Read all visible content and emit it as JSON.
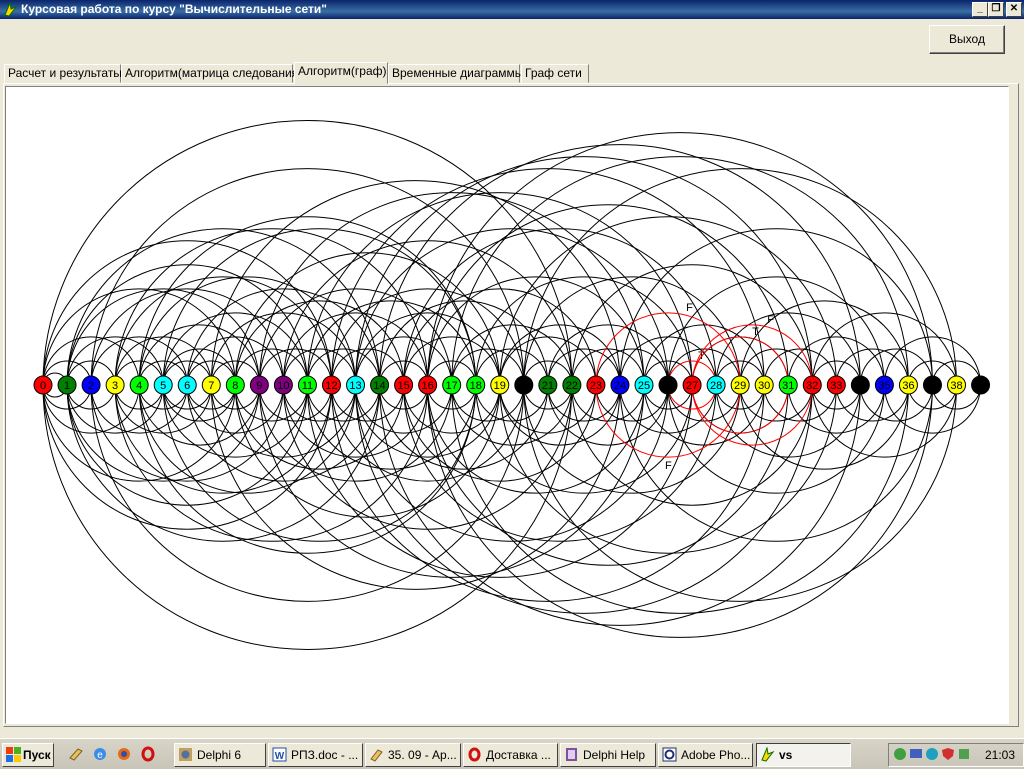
{
  "window": {
    "title": "Курсовая работа по курсу \"Вычислительные сети\""
  },
  "toolbar": {
    "exit_label": "Выход"
  },
  "tabs": [
    {
      "label": "Расчет и результаты"
    },
    {
      "label": "Алгоритм(матрица следования)"
    },
    {
      "label": "Алгоритм(граф)",
      "active": true
    },
    {
      "label": "Временные диаграммы"
    },
    {
      "label": "Граф сети"
    }
  ],
  "graph": {
    "nodes": [
      {
        "label": "0",
        "color": "#ff0000"
      },
      {
        "label": "1",
        "color": "#008000"
      },
      {
        "label": "2",
        "color": "#0000ff"
      },
      {
        "label": "3",
        "color": "#ffff00"
      },
      {
        "label": "4",
        "color": "#00ff00"
      },
      {
        "label": "5",
        "color": "#00ffff"
      },
      {
        "label": "6",
        "color": "#00ffff"
      },
      {
        "label": "7",
        "color": "#ffff00"
      },
      {
        "label": "8",
        "color": "#00ff00"
      },
      {
        "label": "9",
        "color": "#800080"
      },
      {
        "label": "10",
        "color": "#800080"
      },
      {
        "label": "11",
        "color": "#00ff00"
      },
      {
        "label": "12",
        "color": "#ff0000"
      },
      {
        "label": "13",
        "color": "#00ffff"
      },
      {
        "label": "14",
        "color": "#008000"
      },
      {
        "label": "15",
        "color": "#ff0000"
      },
      {
        "label": "16",
        "color": "#ff0000"
      },
      {
        "label": "17",
        "color": "#00ff00"
      },
      {
        "label": "18",
        "color": "#00ff00"
      },
      {
        "label": "19",
        "color": "#ffff00"
      },
      {
        "label": "20",
        "color": "#000000"
      },
      {
        "label": "21",
        "color": "#008000"
      },
      {
        "label": "22",
        "color": "#008000"
      },
      {
        "label": "23",
        "color": "#ff0000"
      },
      {
        "label": "24",
        "color": "#0000ff"
      },
      {
        "label": "25",
        "color": "#00ffff"
      },
      {
        "label": "26",
        "color": "#000000"
      },
      {
        "label": "27",
        "color": "#ff0000"
      },
      {
        "label": "28",
        "color": "#00ffff"
      },
      {
        "label": "29",
        "color": "#ffff00"
      },
      {
        "label": "30",
        "color": "#ffff00"
      },
      {
        "label": "31",
        "color": "#00ff00"
      },
      {
        "label": "32",
        "color": "#ff0000"
      },
      {
        "label": "33",
        "color": "#ff0000"
      },
      {
        "label": "34",
        "color": "#000000"
      },
      {
        "label": "35",
        "color": "#0000ff"
      },
      {
        "label": "36",
        "color": "#ffff00"
      },
      {
        "label": "37",
        "color": "#000000"
      },
      {
        "label": "38",
        "color": "#ffff00"
      },
      {
        "label": "39",
        "color": "#000000"
      }
    ],
    "edges": [
      [
        0,
        1
      ],
      [
        0,
        2
      ],
      [
        0,
        4
      ],
      [
        0,
        8
      ],
      [
        0,
        12
      ],
      [
        0,
        22
      ],
      [
        1,
        3
      ],
      [
        1,
        5
      ],
      [
        1,
        9
      ],
      [
        1,
        14
      ],
      [
        2,
        6
      ],
      [
        2,
        10
      ],
      [
        2,
        20
      ],
      [
        3,
        5
      ],
      [
        3,
        7
      ],
      [
        3,
        12
      ],
      [
        3,
        16
      ],
      [
        4,
        6
      ],
      [
        4,
        9
      ],
      [
        4,
        13
      ],
      [
        5,
        7
      ],
      [
        5,
        8
      ],
      [
        5,
        11
      ],
      [
        5,
        18
      ],
      [
        6,
        8
      ],
      [
        6,
        10
      ],
      [
        6,
        14
      ],
      [
        7,
        9
      ],
      [
        7,
        13
      ],
      [
        7,
        24
      ],
      [
        8,
        11
      ],
      [
        8,
        15
      ],
      [
        8,
        19
      ],
      [
        9,
        12
      ],
      [
        9,
        17
      ],
      [
        10,
        13
      ],
      [
        10,
        16
      ],
      [
        10,
        22
      ],
      [
        11,
        14
      ],
      [
        11,
        18
      ],
      [
        12,
        15
      ],
      [
        12,
        20
      ],
      [
        12,
        30
      ],
      [
        13,
        17
      ],
      [
        13,
        19
      ],
      [
        13,
        26
      ],
      [
        14,
        16
      ],
      [
        14,
        21
      ],
      [
        14,
        34
      ],
      [
        15,
        19
      ],
      [
        15,
        23
      ],
      [
        15,
        28
      ],
      [
        16,
        18
      ],
      [
        16,
        25
      ],
      [
        16,
        31
      ],
      [
        17,
        20
      ],
      [
        17,
        22
      ],
      [
        17,
        36
      ],
      [
        18,
        21
      ],
      [
        18,
        27
      ],
      [
        19,
        23
      ],
      [
        19,
        24
      ],
      [
        19,
        33
      ],
      [
        20,
        22
      ],
      [
        20,
        29
      ],
      [
        20,
        38
      ],
      [
        21,
        24
      ],
      [
        21,
        26
      ],
      [
        22,
        25
      ],
      [
        22,
        32
      ],
      [
        23,
        26
      ],
      [
        24,
        28
      ],
      [
        24,
        37
      ],
      [
        25,
        27
      ],
      [
        25,
        30
      ],
      [
        26,
        29
      ],
      [
        26,
        35
      ],
      [
        27,
        31
      ],
      [
        28,
        30
      ],
      [
        28,
        34
      ],
      [
        29,
        32
      ],
      [
        29,
        36
      ],
      [
        30,
        33
      ],
      [
        31,
        35
      ],
      [
        32,
        34
      ],
      [
        32,
        38
      ],
      [
        33,
        36
      ],
      [
        34,
        37
      ],
      [
        35,
        39
      ],
      [
        36,
        38
      ],
      [
        37,
        39
      ],
      [
        1,
        11
      ],
      [
        4,
        18
      ],
      [
        9,
        25
      ],
      [
        11,
        27
      ],
      [
        13,
        32
      ],
      [
        16,
        37
      ]
    ],
    "highlighted_edges": [
      {
        "from": 23,
        "to": 29,
        "label_top": "F",
        "label_bottom": "F"
      },
      {
        "from": 26,
        "to": 28,
        "label_top": "T",
        "label_bottom": ""
      },
      {
        "from": 27,
        "to": 31,
        "label_top": "T",
        "label_bottom": ""
      },
      {
        "from": 27,
        "to": 32,
        "label_top": "F",
        "label_bottom": ""
      }
    ],
    "edge_color": "#000000",
    "highlight_color": "#ff0000"
  },
  "taskbar": {
    "start_label": "Пуск",
    "tasks": [
      {
        "label": "Delphi 6",
        "icon": "delphi-icon"
      },
      {
        "label": "РПЗ.doc - ...",
        "icon": "word-icon"
      },
      {
        "label": "35. 09 - Ар...",
        "icon": "folder-icon"
      },
      {
        "label": "Доставка ...",
        "icon": "opera-icon"
      },
      {
        "label": "Delphi Help",
        "icon": "help-icon"
      },
      {
        "label": "Adobe Pho...",
        "icon": "photoshop-icon"
      },
      {
        "label": "vs",
        "icon": "app-icon",
        "active": true
      }
    ],
    "clock": "21:03"
  }
}
